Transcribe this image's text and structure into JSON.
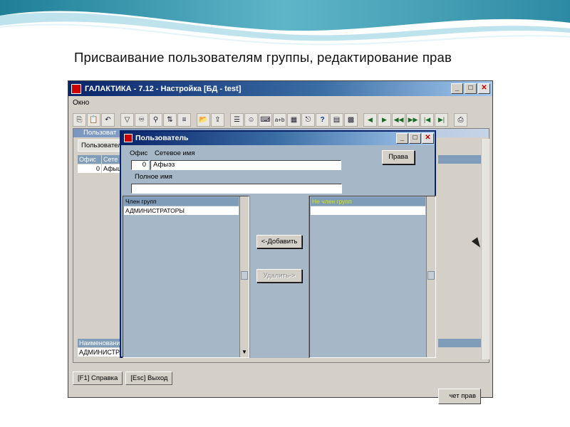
{
  "slide": {
    "title": "Присваивание пользователям группы, редактирование прав"
  },
  "app": {
    "title": "ГАЛАКТИКА - 7.12 - Настройка [БД - test]",
    "menu": [
      "Окно"
    ],
    "background_window": {
      "title": "Пользоват",
      "tab_label": "Пользовател",
      "columns": [
        "Офис",
        "Сете"
      ],
      "row": {
        "office": "0",
        "net": "Афыш"
      },
      "lower_header": "Наименовани",
      "lower_value": "АДМИНИСТРА",
      "right_button": "чет прав"
    },
    "statusbar": {
      "f1": "[F1] Справка",
      "esc": "[Esc] Выход"
    }
  },
  "dialog": {
    "title": "Пользователь",
    "office_label": "Офис",
    "netname_label": "Сетевое имя",
    "office_value": "0",
    "netname_value": "Афыэз",
    "fullname_label": "Полное имя",
    "fullname_value": "",
    "rights_button": "Права",
    "member_header": "Член групп",
    "member_items": [
      "АДМИНИСТРАТОРЫ"
    ],
    "nonmember_header": "Не член групп",
    "nonmember_items": [
      ""
    ],
    "add_button": "<-Добавить",
    "remove_button": "Удалить->"
  },
  "colors": {
    "titlebar": "#0a246a",
    "dialog_bg": "#a6b8c8",
    "grid_header": "#7f9db9",
    "window_bg": "#d4d0c8"
  }
}
